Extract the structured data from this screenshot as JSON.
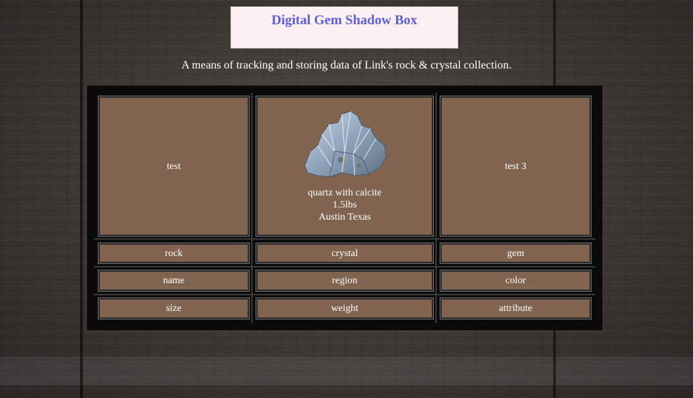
{
  "header": {
    "title": "Digital Gem Shadow Box",
    "subtitle": "A means of tracking and storing data of Link's rock & crystal collection."
  },
  "showcase": {
    "left_label": "test",
    "center": {
      "image_icon": "quartz-crystal-image",
      "line1": "quartz with calcite",
      "line2": "1.5lbs",
      "line3": "Austin Texas"
    },
    "right_label": "test 3"
  },
  "rows": [
    [
      "rock",
      "crystal",
      "gem"
    ],
    [
      "name",
      "region",
      "color"
    ],
    [
      "size",
      "weight",
      "attribute"
    ]
  ],
  "colors": {
    "title_text": "#5a5ee0",
    "title_bg": "#fdf0f5",
    "cell_bg": "#806450",
    "frame": "#0a0a0a"
  }
}
